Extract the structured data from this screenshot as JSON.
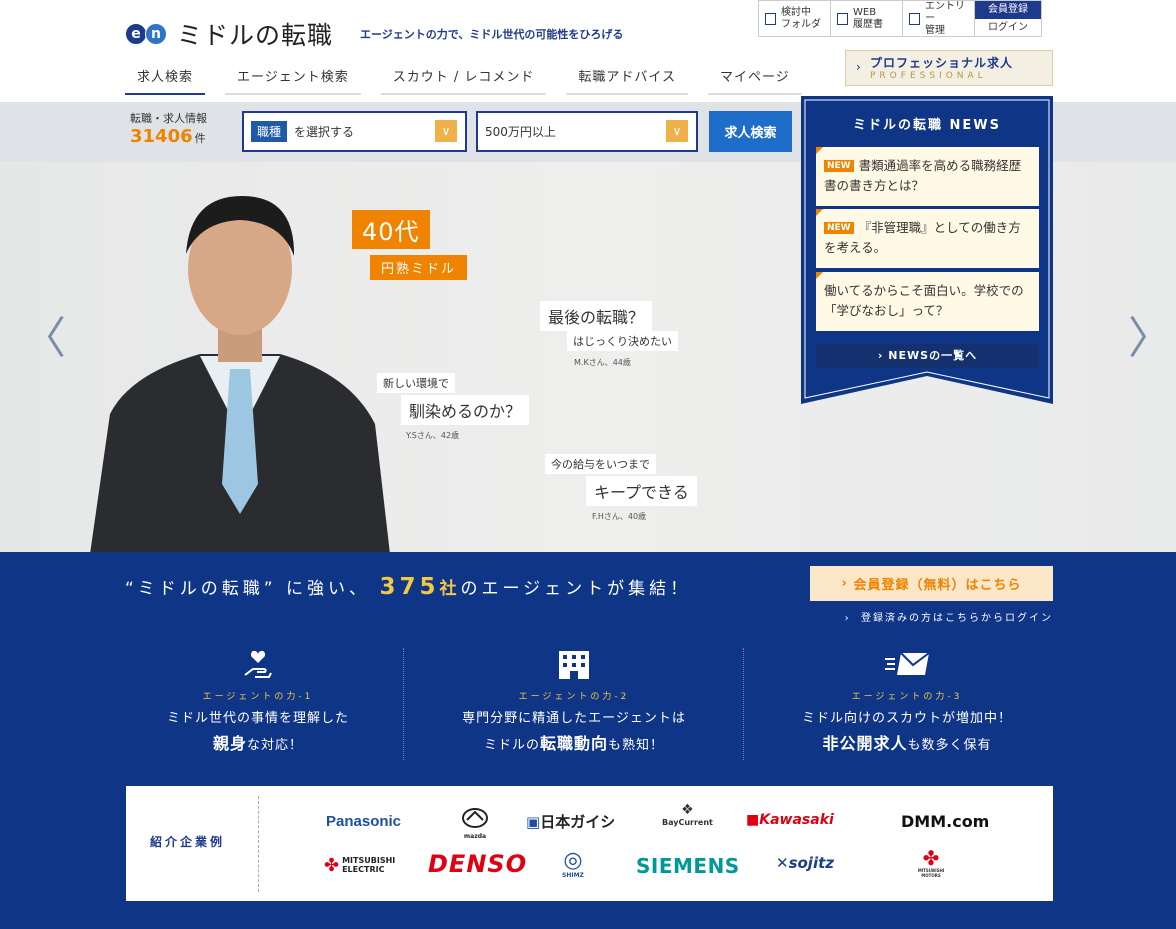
{
  "header": {
    "logo_mark": "en",
    "site_name": "ミドルの転職",
    "tagline": "エージェントの力で、ミドル世代の可能性をひろげる",
    "top_links": [
      {
        "label_1": "検討中",
        "label_2": "フォルダ",
        "icon": "folder-icon"
      },
      {
        "label_1": "WEB",
        "label_2": "履歴書",
        "icon": "resume-icon"
      },
      {
        "label_1": "エントリー",
        "label_2": "管理",
        "icon": "entry-icon"
      }
    ],
    "member_register": "会員登録",
    "login": "ログイン",
    "nav": [
      "求人検索",
      "エージェント検索",
      "スカウト / レコメンド",
      "転職アドバイス",
      "マイページ"
    ],
    "pro_title": "プロフェッショナル求人",
    "pro_sub": "PROFESSIONAL"
  },
  "search": {
    "count_label": "転職・求人情報",
    "count": "31406",
    "count_unit": "件",
    "job_tag": "職種",
    "job_placeholder": "を選択する",
    "salary": "500万円以上",
    "button": "求人検索"
  },
  "hero": {
    "age": "40代",
    "age_sub": "円熟ミドル",
    "quotes": [
      {
        "small": "はじっくり決めたい",
        "big": "最後の転職？",
        "name": "M.Kさん、44歳"
      },
      {
        "small": "新しい環境で",
        "big": "馴染めるのか？",
        "name": "Y.Sさん、42歳"
      },
      {
        "small": "今の給与をいつまで",
        "big": "キープできる",
        "name": "F.Hさん、40歳"
      }
    ]
  },
  "news": {
    "title": "ミドルの転職 NEWS",
    "new_badge": "NEW",
    "items": [
      {
        "text": "書類通過率を高める職務経歴書の書き方とは？",
        "is_new": true
      },
      {
        "text": "『非管理職』としての働き方を考える。",
        "is_new": true
      },
      {
        "text": "働いてるからこそ面白い。学校での「学びなおし」って？",
        "is_new": false
      }
    ],
    "more": "NEWSの一覧へ"
  },
  "agents": {
    "headline_pre": "“ミドルの転職” に強い、",
    "headline_num": "375",
    "headline_unit": "社",
    "headline_post": "のエージェントが集結！",
    "register_button": "会員登録（無料）はこちら",
    "login_link": "登録済みの方はこちらからログイン",
    "powers": [
      {
        "label": "エージェントの力-1",
        "line1": "ミドル世代の事情を理解した",
        "bold": "親身",
        "rest": "な対応！",
        "icon": "hand-heart-icon"
      },
      {
        "label": "エージェントの力-2",
        "line1": "専門分野に精通したエージェントは",
        "pre": "ミドルの",
        "bold": "転職動向",
        "rest": "も熟知！",
        "icon": "building-icon"
      },
      {
        "label": "エージェントの力-3",
        "line1": "ミドル向けのスカウトが増加中！",
        "bold": "非公開求人",
        "rest": "も数多く保有",
        "icon": "mail-icon"
      }
    ]
  },
  "companies": {
    "label": "紹介企業例",
    "logos": [
      "Panasonic",
      "mazda",
      "日本ガイシ",
      "BayCurrent",
      "Kawasaki",
      "DMM.com",
      "MITSUBISHI ELECTRIC",
      "DENSO",
      "SHIMZ",
      "SIEMENS",
      "sojitz",
      "MITSUBISHI MOTORS"
    ]
  },
  "colors": {
    "navy": "#0f3587",
    "orange": "#f08300",
    "gold": "#f5c844"
  }
}
